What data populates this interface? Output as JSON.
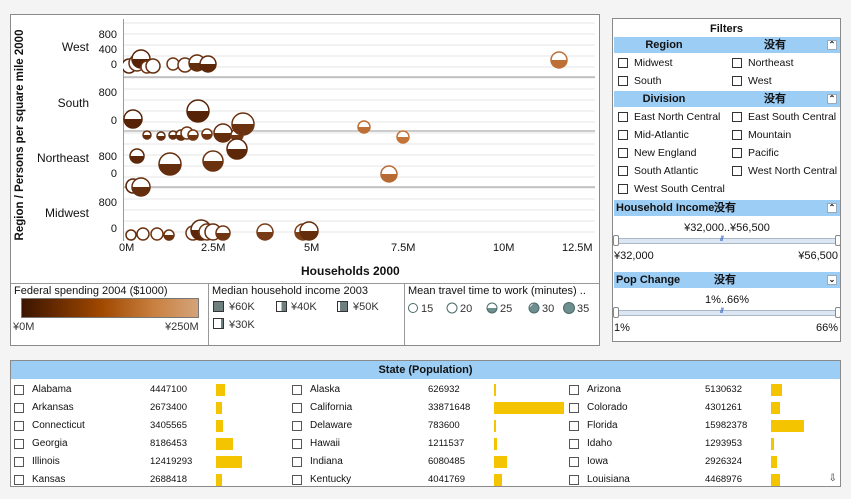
{
  "chart": {
    "y_axis_title": "Region / Persons per square mile 2000",
    "x_axis_title": "Households 2000",
    "regions": [
      "West",
      "South",
      "Northeast",
      "Midwest"
    ],
    "y_ticks": {
      "West": [
        "800",
        "400",
        "0"
      ],
      "South": [
        "800",
        "0"
      ],
      "Northeast": [
        "800",
        "0"
      ],
      "Midwest": [
        "800",
        "0"
      ]
    },
    "x_ticks": [
      "0M",
      "2.5M",
      "5M",
      "7.5M",
      "10M",
      "12.5M"
    ]
  },
  "legends": {
    "color": {
      "title": "Federal spending 2004 ($1000)",
      "min": "¥0M",
      "max": "¥250M"
    },
    "shape": {
      "title": "Median household income 2003",
      "items": [
        "¥60K",
        "¥40K",
        "¥50K",
        "¥30K"
      ]
    },
    "size": {
      "title": "Mean travel time to work (minutes) ..",
      "items": [
        "15",
        "20",
        "25",
        "30",
        "35"
      ]
    }
  },
  "filters": {
    "title": "Filters",
    "region": {
      "label": "Region",
      "status": "没有",
      "options": [
        "Midwest",
        "Northeast",
        "South",
        "West"
      ]
    },
    "division": {
      "label": "Division",
      "status": "没有",
      "options": [
        "East North Central",
        "East South Central",
        "Mid-Atlantic",
        "Mountain",
        "New England",
        "Pacific",
        "South Atlantic",
        "West North Central",
        "West South Central"
      ]
    },
    "household_income": {
      "label": "Household Income",
      "status": "没有",
      "range": "¥32,000..¥56,500",
      "min": "¥32,000",
      "max": "¥56,500"
    },
    "pop_change": {
      "label": "Pop Change",
      "status": "没有",
      "range": "1%..66%",
      "min": "1%",
      "max": "66%"
    }
  },
  "state_list": {
    "title": "State (Population)",
    "max_population": 33871648,
    "rows": [
      [
        {
          "name": "Alabama",
          "pop": "4447100",
          "value": 4447100
        },
        {
          "name": "Alaska",
          "pop": "626932",
          "value": 626932
        },
        {
          "name": "Arizona",
          "pop": "5130632",
          "value": 5130632
        }
      ],
      [
        {
          "name": "Arkansas",
          "pop": "2673400",
          "value": 2673400
        },
        {
          "name": "California",
          "pop": "33871648",
          "value": 33871648
        },
        {
          "name": "Colorado",
          "pop": "4301261",
          "value": 4301261
        }
      ],
      [
        {
          "name": "Connecticut",
          "pop": "3405565",
          "value": 3405565
        },
        {
          "name": "Delaware",
          "pop": "783600",
          "value": 783600
        },
        {
          "name": "Florida",
          "pop": "15982378",
          "value": 15982378
        }
      ],
      [
        {
          "name": "Georgia",
          "pop": "8186453",
          "value": 8186453
        },
        {
          "name": "Hawaii",
          "pop": "1211537",
          "value": 1211537
        },
        {
          "name": "Idaho",
          "pop": "1293953",
          "value": 1293953
        }
      ],
      [
        {
          "name": "Illinois",
          "pop": "12419293",
          "value": 12419293
        },
        {
          "name": "Indiana",
          "pop": "6080485",
          "value": 6080485
        },
        {
          "name": "Iowa",
          "pop": "2926324",
          "value": 2926324
        }
      ],
      [
        {
          "name": "Kansas",
          "pop": "2688418",
          "value": 2688418
        },
        {
          "name": "Kentucky",
          "pop": "4041769",
          "value": 4041769
        },
        {
          "name": "Louisiana",
          "pop": "4468976",
          "value": 4468976
        }
      ]
    ]
  },
  "colors": {
    "accent": "#9ccdf5",
    "bar": "#f5c400",
    "bubble_dark": "#4a1a00",
    "bubble_light": "#c0692a"
  }
}
